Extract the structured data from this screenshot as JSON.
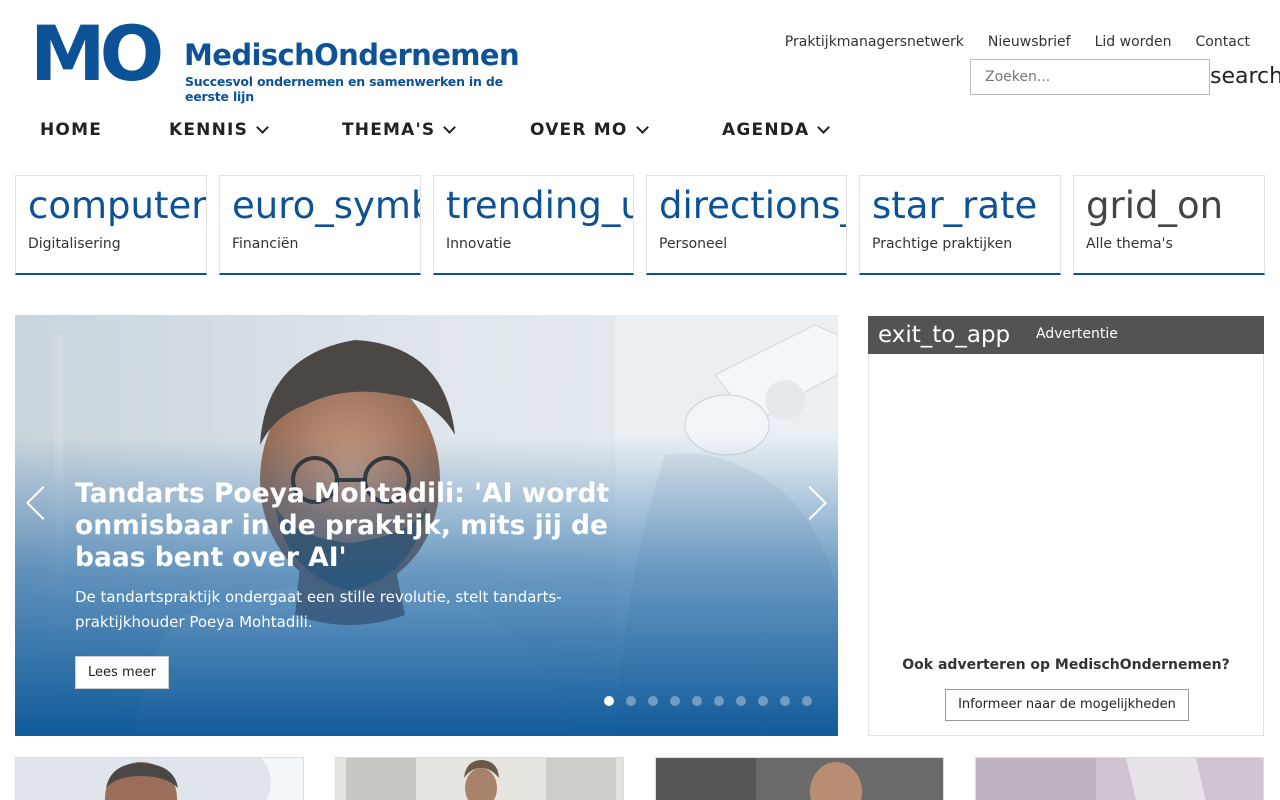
{
  "header": {
    "logo_mark": "MO",
    "brand_name": "MedischOndernemen",
    "tagline": "Succesvol ondernemen en samenwerken in de eerste lijn",
    "top_links": [
      "Praktijkmanagersnetwerk",
      "Nieuwsbrief",
      "Lid worden",
      "Contact"
    ],
    "search": {
      "placeholder": "Zoeken...",
      "button_label": "search"
    }
  },
  "nav": {
    "items": [
      {
        "label": "HOME",
        "dropdown": false
      },
      {
        "label": "KENNIS",
        "dropdown": true
      },
      {
        "label": "THEMA'S",
        "dropdown": true
      },
      {
        "label": "OVER MO",
        "dropdown": true
      },
      {
        "label": "AGENDA",
        "dropdown": true
      }
    ]
  },
  "themes": [
    {
      "icon": "computer",
      "label": "Digitalisering"
    },
    {
      "icon": "euro_symbol",
      "label": "Financiën"
    },
    {
      "icon": "trending_up",
      "label": "Innovatie"
    },
    {
      "icon": "directions_walk",
      "label": "Personeel"
    },
    {
      "icon": "star_rate",
      "label": "Prachtige praktijken"
    },
    {
      "icon": "grid_on",
      "label": "Alle thema's"
    }
  ],
  "hero": {
    "title": "Tandarts Poeya Mohtadili: 'AI wordt onmisbaar in de praktijk, mits jij de baas bent over AI'",
    "subtitle": "De tandartspraktijk ondergaat een stille revolutie, stelt tandarts-praktijkhouder Poeya Mohtadili.",
    "button_label": "Lees meer",
    "slide_count": 10,
    "active_slide": 1
  },
  "ad": {
    "icon": "exit_to_app",
    "label": "Advertentie",
    "question": "Ook adverteren op MedischOndernemen?",
    "button_label": "Informeer naar de mogelijkheden"
  },
  "colors": {
    "brand_blue": "#0d5296",
    "ad_bar": "#555352",
    "hero_overlay": "#0654a0"
  }
}
